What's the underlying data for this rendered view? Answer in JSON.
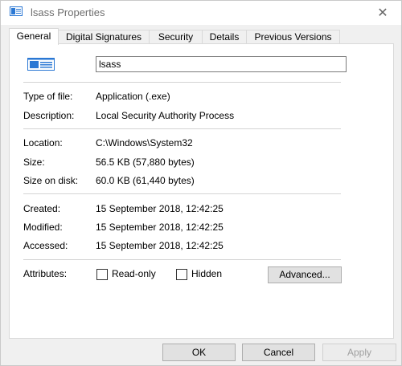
{
  "window": {
    "title": "lsass Properties",
    "close_glyph": "✕"
  },
  "tabs": [
    {
      "label": "General"
    },
    {
      "label": "Digital Signatures"
    },
    {
      "label": "Security"
    },
    {
      "label": "Details"
    },
    {
      "label": "Previous Versions"
    }
  ],
  "general": {
    "file_name": "lsass",
    "type_label": "Type of file:",
    "type_value": "Application (.exe)",
    "description_label": "Description:",
    "description_value": "Local Security Authority Process",
    "location_label": "Location:",
    "location_value": "C:\\Windows\\System32",
    "size_label": "Size:",
    "size_value": "56.5 KB (57,880 bytes)",
    "size_on_disk_label": "Size on disk:",
    "size_on_disk_value": "60.0 KB (61,440 bytes)",
    "created_label": "Created:",
    "created_value": "15 September 2018, 12:42:25",
    "modified_label": "Modified:",
    "modified_value": "15 September 2018, 12:42:25",
    "accessed_label": "Accessed:",
    "accessed_value": "15 September 2018, 12:42:25",
    "attributes_label": "Attributes:",
    "readonly_label": "Read-only",
    "hidden_label": "Hidden",
    "advanced_label": "Advanced..."
  },
  "footer": {
    "ok_label": "OK",
    "cancel_label": "Cancel",
    "apply_label": "Apply"
  },
  "colors": {
    "window_bg": "#f0f0f0",
    "panel_bg": "#ffffff",
    "icon_blue": "#2b78d4"
  }
}
